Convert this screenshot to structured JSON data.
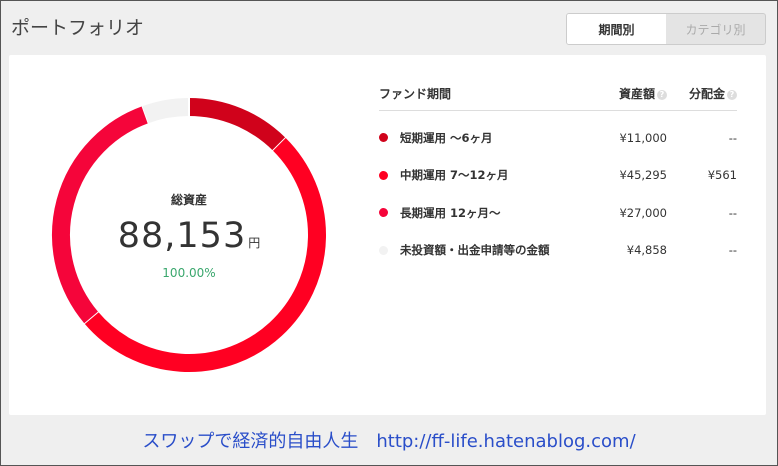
{
  "header": {
    "title": "ポートフォリオ",
    "tabs": [
      {
        "label": "期間別",
        "active": true
      },
      {
        "label": "カテゴリ別",
        "active": false
      }
    ]
  },
  "donut": {
    "label": "総資産",
    "value": "88,153",
    "unit": "円",
    "percent": "100.00%"
  },
  "table": {
    "headers": {
      "name": "ファンド期間",
      "amount": "資産額",
      "distribution": "分配金"
    },
    "rows": [
      {
        "name": "短期運用 ～6ヶ月",
        "amount": "¥11,000",
        "distribution": "--",
        "color": "#d0021b",
        "value": 11000
      },
      {
        "name": "中期運用 7～12ヶ月",
        "amount": "¥45,295",
        "distribution": "¥561",
        "color": "#ff0022",
        "value": 45295
      },
      {
        "name": "長期運用 12ヶ月～",
        "amount": "¥27,000",
        "distribution": "--",
        "color": "#f5053a",
        "value": 27000
      },
      {
        "name": "未投資額・出金申請等の金額",
        "amount": "¥4,858",
        "distribution": "--",
        "color": "#f2f2f2",
        "value": 4858
      }
    ]
  },
  "footer": {
    "watermark": "スワップで経済的自由人生　http://ff-life.hatenablog.com/"
  },
  "chart_data": {
    "type": "pie",
    "categories": [
      "短期運用 ～6ヶ月",
      "中期運用 7～12ヶ月",
      "長期運用 12ヶ月～",
      "未投資額・出金申請等の金額"
    ],
    "values": [
      11000,
      45295,
      27000,
      4858
    ]
  }
}
